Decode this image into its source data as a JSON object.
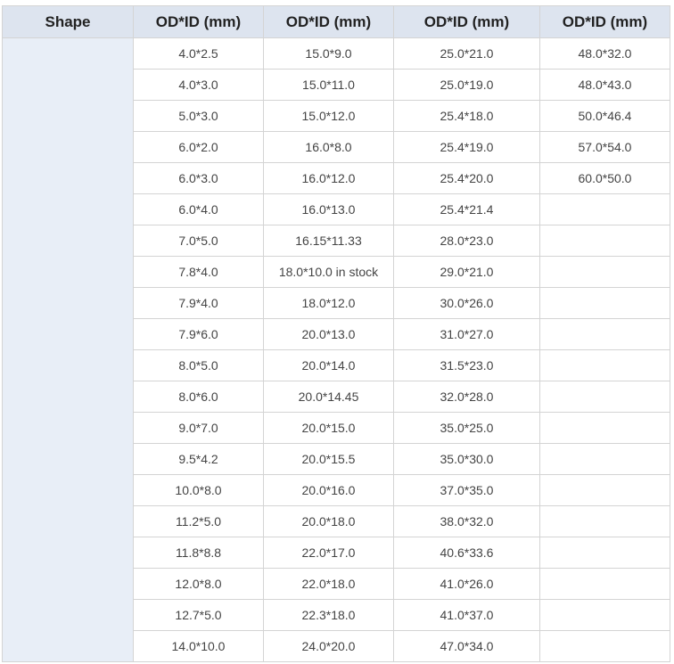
{
  "colors": {
    "header_bg": "#dde4ef",
    "shape_cell_bg": "#e8eef7",
    "border": "#d4d4d4",
    "text": "#444444"
  },
  "table": {
    "headers": [
      "Shape",
      "OD*ID (mm)",
      "OD*ID (mm)",
      "OD*ID (mm)",
      "OD*ID (mm)"
    ],
    "shape_value": "",
    "rows": [
      [
        "4.0*2.5",
        "15.0*9.0",
        "25.0*21.0",
        "48.0*32.0"
      ],
      [
        "4.0*3.0",
        "15.0*11.0",
        "25.0*19.0",
        "48.0*43.0"
      ],
      [
        "5.0*3.0",
        "15.0*12.0",
        "25.4*18.0",
        "50.0*46.4"
      ],
      [
        "6.0*2.0",
        "16.0*8.0",
        "25.4*19.0",
        "57.0*54.0"
      ],
      [
        "6.0*3.0",
        "16.0*12.0",
        "25.4*20.0",
        "60.0*50.0"
      ],
      [
        "6.0*4.0",
        "16.0*13.0",
        "25.4*21.4",
        ""
      ],
      [
        "7.0*5.0",
        "16.15*11.33",
        "28.0*23.0",
        ""
      ],
      [
        "7.8*4.0",
        "18.0*10.0 in stock",
        "29.0*21.0",
        ""
      ],
      [
        "7.9*4.0",
        "18.0*12.0",
        "30.0*26.0",
        ""
      ],
      [
        "7.9*6.0",
        "20.0*13.0",
        "31.0*27.0",
        ""
      ],
      [
        "8.0*5.0",
        "20.0*14.0",
        "31.5*23.0",
        ""
      ],
      [
        "8.0*6.0",
        "20.0*14.45",
        "32.0*28.0",
        ""
      ],
      [
        "9.0*7.0",
        "20.0*15.0",
        "35.0*25.0",
        ""
      ],
      [
        "9.5*4.2",
        "20.0*15.5",
        "35.0*30.0",
        ""
      ],
      [
        "10.0*8.0",
        "20.0*16.0",
        "37.0*35.0",
        ""
      ],
      [
        "11.2*5.0",
        "20.0*18.0",
        "38.0*32.0",
        ""
      ],
      [
        "11.8*8.8",
        "22.0*17.0",
        "40.6*33.6",
        ""
      ],
      [
        "12.0*8.0",
        "22.0*18.0",
        "41.0*26.0",
        ""
      ],
      [
        "12.7*5.0",
        "22.3*18.0",
        "41.0*37.0",
        ""
      ],
      [
        "14.0*10.0",
        "24.0*20.0",
        "47.0*34.0",
        ""
      ]
    ]
  }
}
